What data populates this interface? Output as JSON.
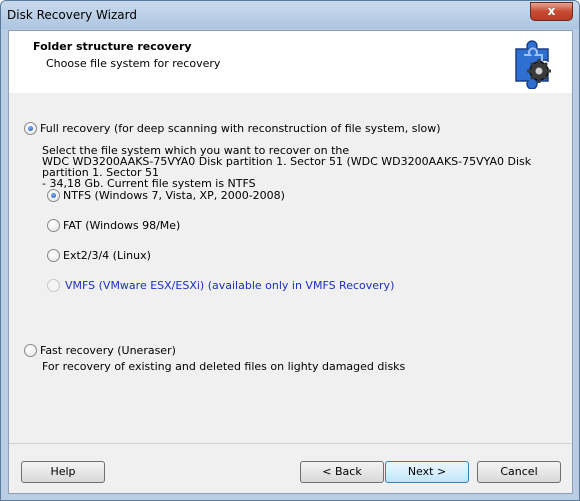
{
  "window": {
    "title": "Disk Recovery Wizard",
    "close_glyph": "x"
  },
  "header": {
    "title": "Folder structure recovery",
    "subtitle": "Choose file system for recovery",
    "icon": "puzzle-gear-icon"
  },
  "options": {
    "full": {
      "label": "Full recovery (for deep scanning with reconstruction of file system, slow)",
      "selected": true,
      "description_line1": "Select the file system which you want to recover on the",
      "description_line2": "WDC WD3200AAKS-75VYA0 Disk partition 1. Sector 51 (WDC WD3200AAKS-75VYA0 Disk partition 1. Sector 51",
      "description_line3": "- 34,18 Gb. Current file system is NTFS"
    },
    "filesystems": [
      {
        "label": "NTFS (Windows 7, Vista, XP, 2000-2008)",
        "selected": true,
        "enabled": true
      },
      {
        "label": "FAT (Windows 98/Me)",
        "selected": false,
        "enabled": true
      },
      {
        "label": "Ext2/3/4 (Linux)",
        "selected": false,
        "enabled": true
      },
      {
        "label": "VMFS (VMware ESX/ESXi) (available only in VMFS Recovery)",
        "selected": false,
        "enabled": false
      }
    ],
    "fast": {
      "label": "Fast recovery (Uneraser)",
      "selected": false,
      "description": "For recovery of existing and deleted files on lighty damaged disks"
    }
  },
  "buttons": {
    "help": "Help",
    "back": "< Back",
    "next": "Next >",
    "cancel": "Cancel"
  }
}
